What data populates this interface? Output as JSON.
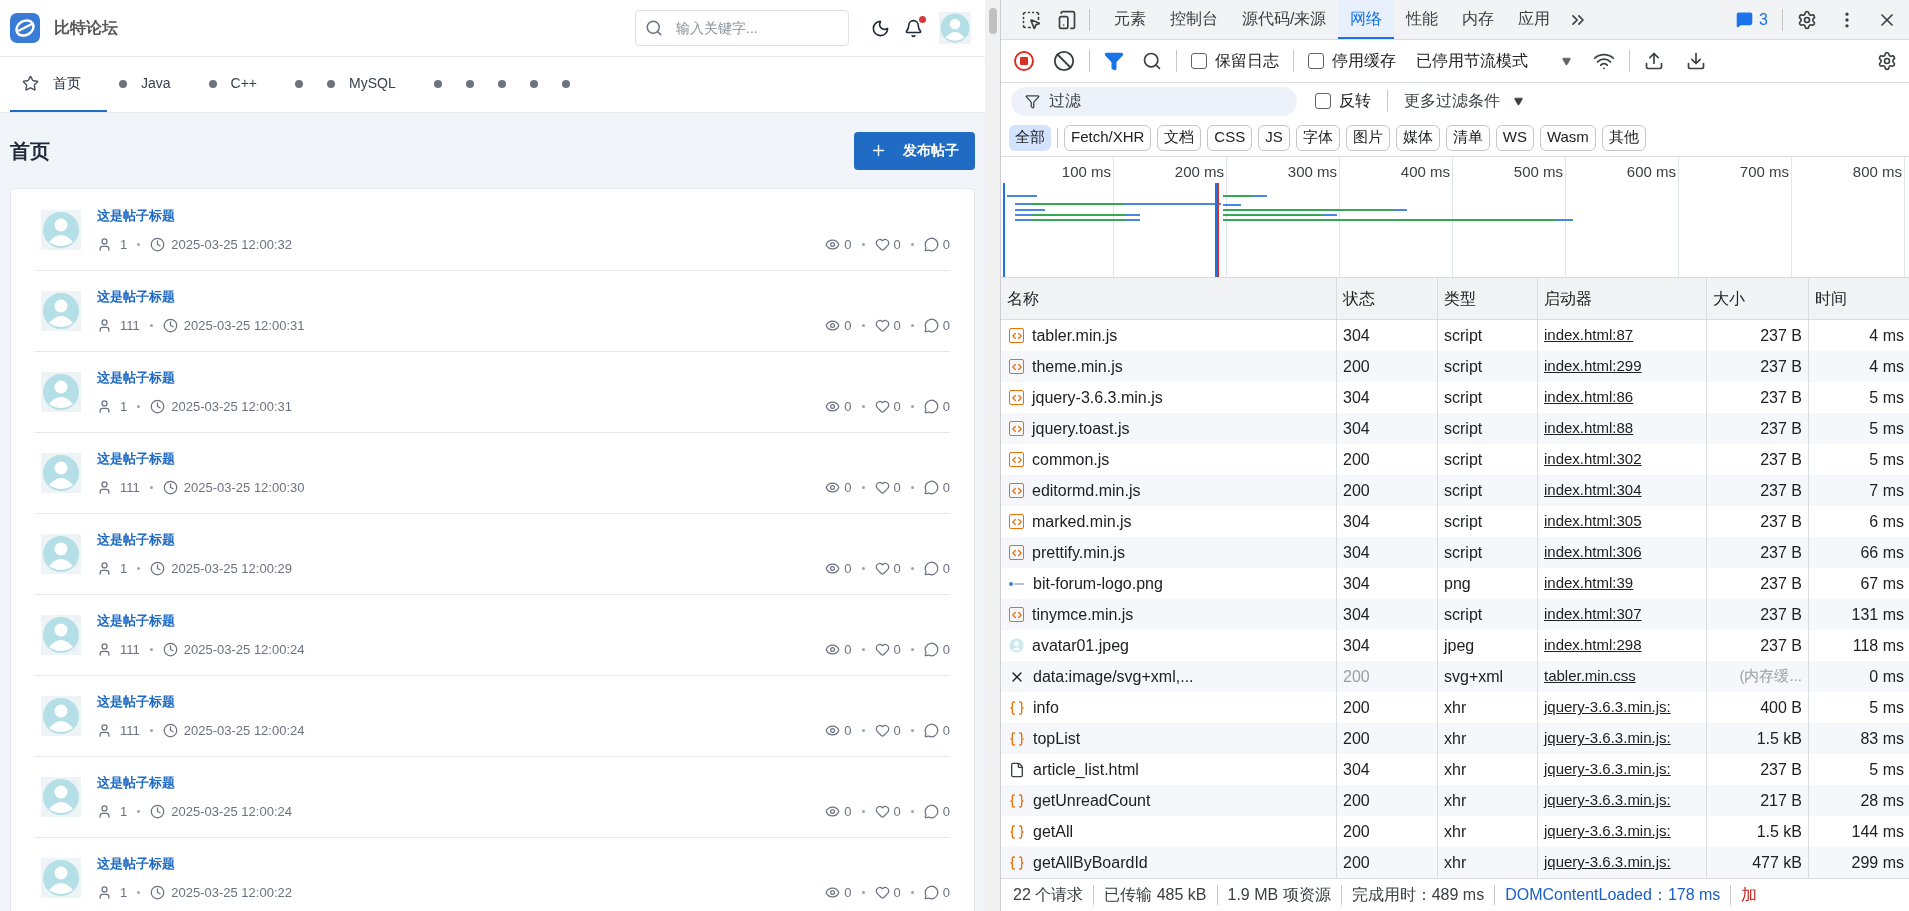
{
  "site": {
    "name": "比特论坛",
    "search_placeholder": "输入关键字...",
    "has_notification": true
  },
  "nav": [
    {
      "kind": "home",
      "label": "首页",
      "selected": true
    },
    {
      "kind": "board",
      "label": "Java",
      "selected": false
    },
    {
      "kind": "board",
      "label": "C++",
      "selected": false
    },
    {
      "kind": "board",
      "selected": false
    },
    {
      "kind": "board",
      "label": "MySQL",
      "selected": false
    },
    {
      "kind": "board",
      "selected": false
    },
    {
      "kind": "board",
      "selected": false
    },
    {
      "kind": "board",
      "selected": false
    },
    {
      "kind": "board",
      "selected": false
    },
    {
      "kind": "board",
      "selected": false
    }
  ],
  "page_title": "首页",
  "new_post_button": "发布帖子",
  "posts": [
    {
      "title": "这是帖子标题",
      "author": "1",
      "time": "2025-03-25 12:00:32",
      "views": "0",
      "likes": "0",
      "replies": "0"
    },
    {
      "title": "这是帖子标题",
      "author": "111",
      "time": "2025-03-25 12:00:31",
      "views": "0",
      "likes": "0",
      "replies": "0"
    },
    {
      "title": "这是帖子标题",
      "author": "1",
      "time": "2025-03-25 12:00:31",
      "views": "0",
      "likes": "0",
      "replies": "0"
    },
    {
      "title": "这是帖子标题",
      "author": "111",
      "time": "2025-03-25 12:00:30",
      "views": "0",
      "likes": "0",
      "replies": "0"
    },
    {
      "title": "这是帖子标题",
      "author": "1",
      "time": "2025-03-25 12:00:29",
      "views": "0",
      "likes": "0",
      "replies": "0"
    },
    {
      "title": "这是帖子标题",
      "author": "111",
      "time": "2025-03-25 12:00:24",
      "views": "0",
      "likes": "0",
      "replies": "0"
    },
    {
      "title": "这是帖子标题",
      "author": "111",
      "time": "2025-03-25 12:00:24",
      "views": "0",
      "likes": "0",
      "replies": "0"
    },
    {
      "title": "这是帖子标题",
      "author": "1",
      "time": "2025-03-25 12:00:24",
      "views": "0",
      "likes": "0",
      "replies": "0"
    },
    {
      "title": "这是帖子标题",
      "author": "1",
      "time": "2025-03-25 12:00:22",
      "views": "0",
      "likes": "0",
      "replies": "0"
    }
  ],
  "devtools": {
    "tabs": [
      {
        "label": "元素",
        "selected": false
      },
      {
        "label": "控制台",
        "selected": false
      },
      {
        "label": "源代码/来源",
        "selected": false
      },
      {
        "label": "网络",
        "selected": true
      },
      {
        "label": "性能",
        "selected": false
      },
      {
        "label": "内存",
        "selected": false
      },
      {
        "label": "应用",
        "selected": false
      }
    ],
    "issues_count": "3",
    "recording": true,
    "preserve_log": {
      "label": "保留日志",
      "checked": false
    },
    "disable_cache": {
      "label": "停用缓存",
      "checked": false
    },
    "throttling": "已停用节流模式",
    "filter": {
      "placeholder": "过滤"
    },
    "invert": {
      "label": "反转",
      "checked": false
    },
    "more_filters": "更多过滤条件",
    "type_filters": [
      {
        "label": "全部",
        "selected": true
      },
      {
        "label": "Fetch/XHR",
        "selected": false
      },
      {
        "label": "文档",
        "selected": false
      },
      {
        "label": "CSS",
        "selected": false
      },
      {
        "label": "JS",
        "selected": false
      },
      {
        "label": "字体",
        "selected": false
      },
      {
        "label": "图片",
        "selected": false
      },
      {
        "label": "媒体",
        "selected": false
      },
      {
        "label": "清单",
        "selected": false
      },
      {
        "label": "WS",
        "selected": false
      },
      {
        "label": "Wasm",
        "selected": false
      },
      {
        "label": "其他",
        "selected": false
      }
    ],
    "timeline_ticks": [
      "100 ms",
      "200 ms",
      "300 ms",
      "400 ms",
      "500 ms",
      "600 ms",
      "700 ms",
      "800 ms"
    ],
    "columns": [
      "名称",
      "状态",
      "类型",
      "启动器",
      "大小",
      "时间"
    ],
    "rows": [
      {
        "kind": "script",
        "name": "tabler.min.js",
        "status": "304",
        "type": "script",
        "initiator": "index.html:87",
        "size": "237 B",
        "time": "4 ms",
        "dim": false
      },
      {
        "kind": "script",
        "name": "theme.min.js",
        "status": "200",
        "type": "script",
        "initiator": "index.html:299",
        "size": "237 B",
        "time": "4 ms",
        "dim": false
      },
      {
        "kind": "script",
        "name": "jquery-3.6.3.min.js",
        "status": "304",
        "type": "script",
        "initiator": "index.html:86",
        "size": "237 B",
        "time": "5 ms",
        "dim": false
      },
      {
        "kind": "script",
        "name": "jquery.toast.js",
        "status": "304",
        "type": "script",
        "initiator": "index.html:88",
        "size": "237 B",
        "time": "5 ms",
        "dim": false
      },
      {
        "kind": "script",
        "name": "common.js",
        "status": "200",
        "type": "script",
        "initiator": "index.html:302",
        "size": "237 B",
        "time": "5 ms",
        "dim": false
      },
      {
        "kind": "script",
        "name": "editormd.min.js",
        "status": "200",
        "type": "script",
        "initiator": "index.html:304",
        "size": "237 B",
        "time": "7 ms",
        "dim": false
      },
      {
        "kind": "script",
        "name": "marked.min.js",
        "status": "304",
        "type": "script",
        "initiator": "index.html:305",
        "size": "237 B",
        "time": "6 ms",
        "dim": false
      },
      {
        "kind": "script",
        "name": "prettify.min.js",
        "status": "304",
        "type": "script",
        "initiator": "index.html:306",
        "size": "237 B",
        "time": "66 ms",
        "dim": false
      },
      {
        "kind": "logo",
        "name": "bit-forum-logo.png",
        "status": "304",
        "type": "png",
        "initiator": "index.html:39",
        "size": "237 B",
        "time": "67 ms",
        "dim": false
      },
      {
        "kind": "script",
        "name": "tinymce.min.js",
        "status": "304",
        "type": "script",
        "initiator": "index.html:307",
        "size": "237 B",
        "time": "131 ms",
        "dim": false
      },
      {
        "kind": "avatar",
        "name": "avatar01.jpeg",
        "status": "304",
        "type": "jpeg",
        "initiator": "index.html:298",
        "size": "237 B",
        "time": "118 ms",
        "dim": false
      },
      {
        "kind": "svg",
        "name": "data:image/svg+xml,...",
        "status": "200",
        "type": "svg+xml",
        "initiator": "tabler.min.css",
        "size": "(内存缓...",
        "time": "0 ms",
        "dim": true
      },
      {
        "kind": "xhr",
        "name": "info",
        "status": "200",
        "type": "xhr",
        "initiator": "jquery-3.6.3.min.js:",
        "size": "400 B",
        "time": "5 ms",
        "dim": false
      },
      {
        "kind": "xhr",
        "name": "topList",
        "status": "200",
        "type": "xhr",
        "initiator": "jquery-3.6.3.min.js:",
        "size": "1.5 kB",
        "time": "83 ms",
        "dim": false
      },
      {
        "kind": "document",
        "name": "article_list.html",
        "status": "304",
        "type": "xhr",
        "initiator": "jquery-3.6.3.min.js:",
        "size": "237 B",
        "time": "5 ms",
        "dim": false
      },
      {
        "kind": "xhr",
        "name": "getUnreadCount",
        "status": "200",
        "type": "xhr",
        "initiator": "jquery-3.6.3.min.js:",
        "size": "217 B",
        "time": "28 ms",
        "dim": false
      },
      {
        "kind": "xhr",
        "name": "getAll",
        "status": "200",
        "type": "xhr",
        "initiator": "jquery-3.6.3.min.js:",
        "size": "1.5 kB",
        "time": "144 ms",
        "dim": false
      },
      {
        "kind": "xhr",
        "name": "getAllByBoardId",
        "status": "200",
        "type": "xhr",
        "initiator": "jquery-3.6.3.min.js:",
        "size": "477 kB",
        "time": "299 ms",
        "dim": false
      }
    ],
    "status_bar": [
      {
        "text": "22 个请求",
        "color": "#3c4043"
      },
      {
        "text": "已传输 485 kB",
        "color": "#3c4043"
      },
      {
        "text": "1.9 MB 项资源",
        "color": "#3c4043"
      },
      {
        "text": "完成用时：489 ms",
        "color": "#3c4043"
      },
      {
        "text": "DOMContentLoaded：178 ms",
        "color": "#1a5fc8"
      },
      {
        "text": "加",
        "color": "#c5221f"
      }
    ]
  }
}
